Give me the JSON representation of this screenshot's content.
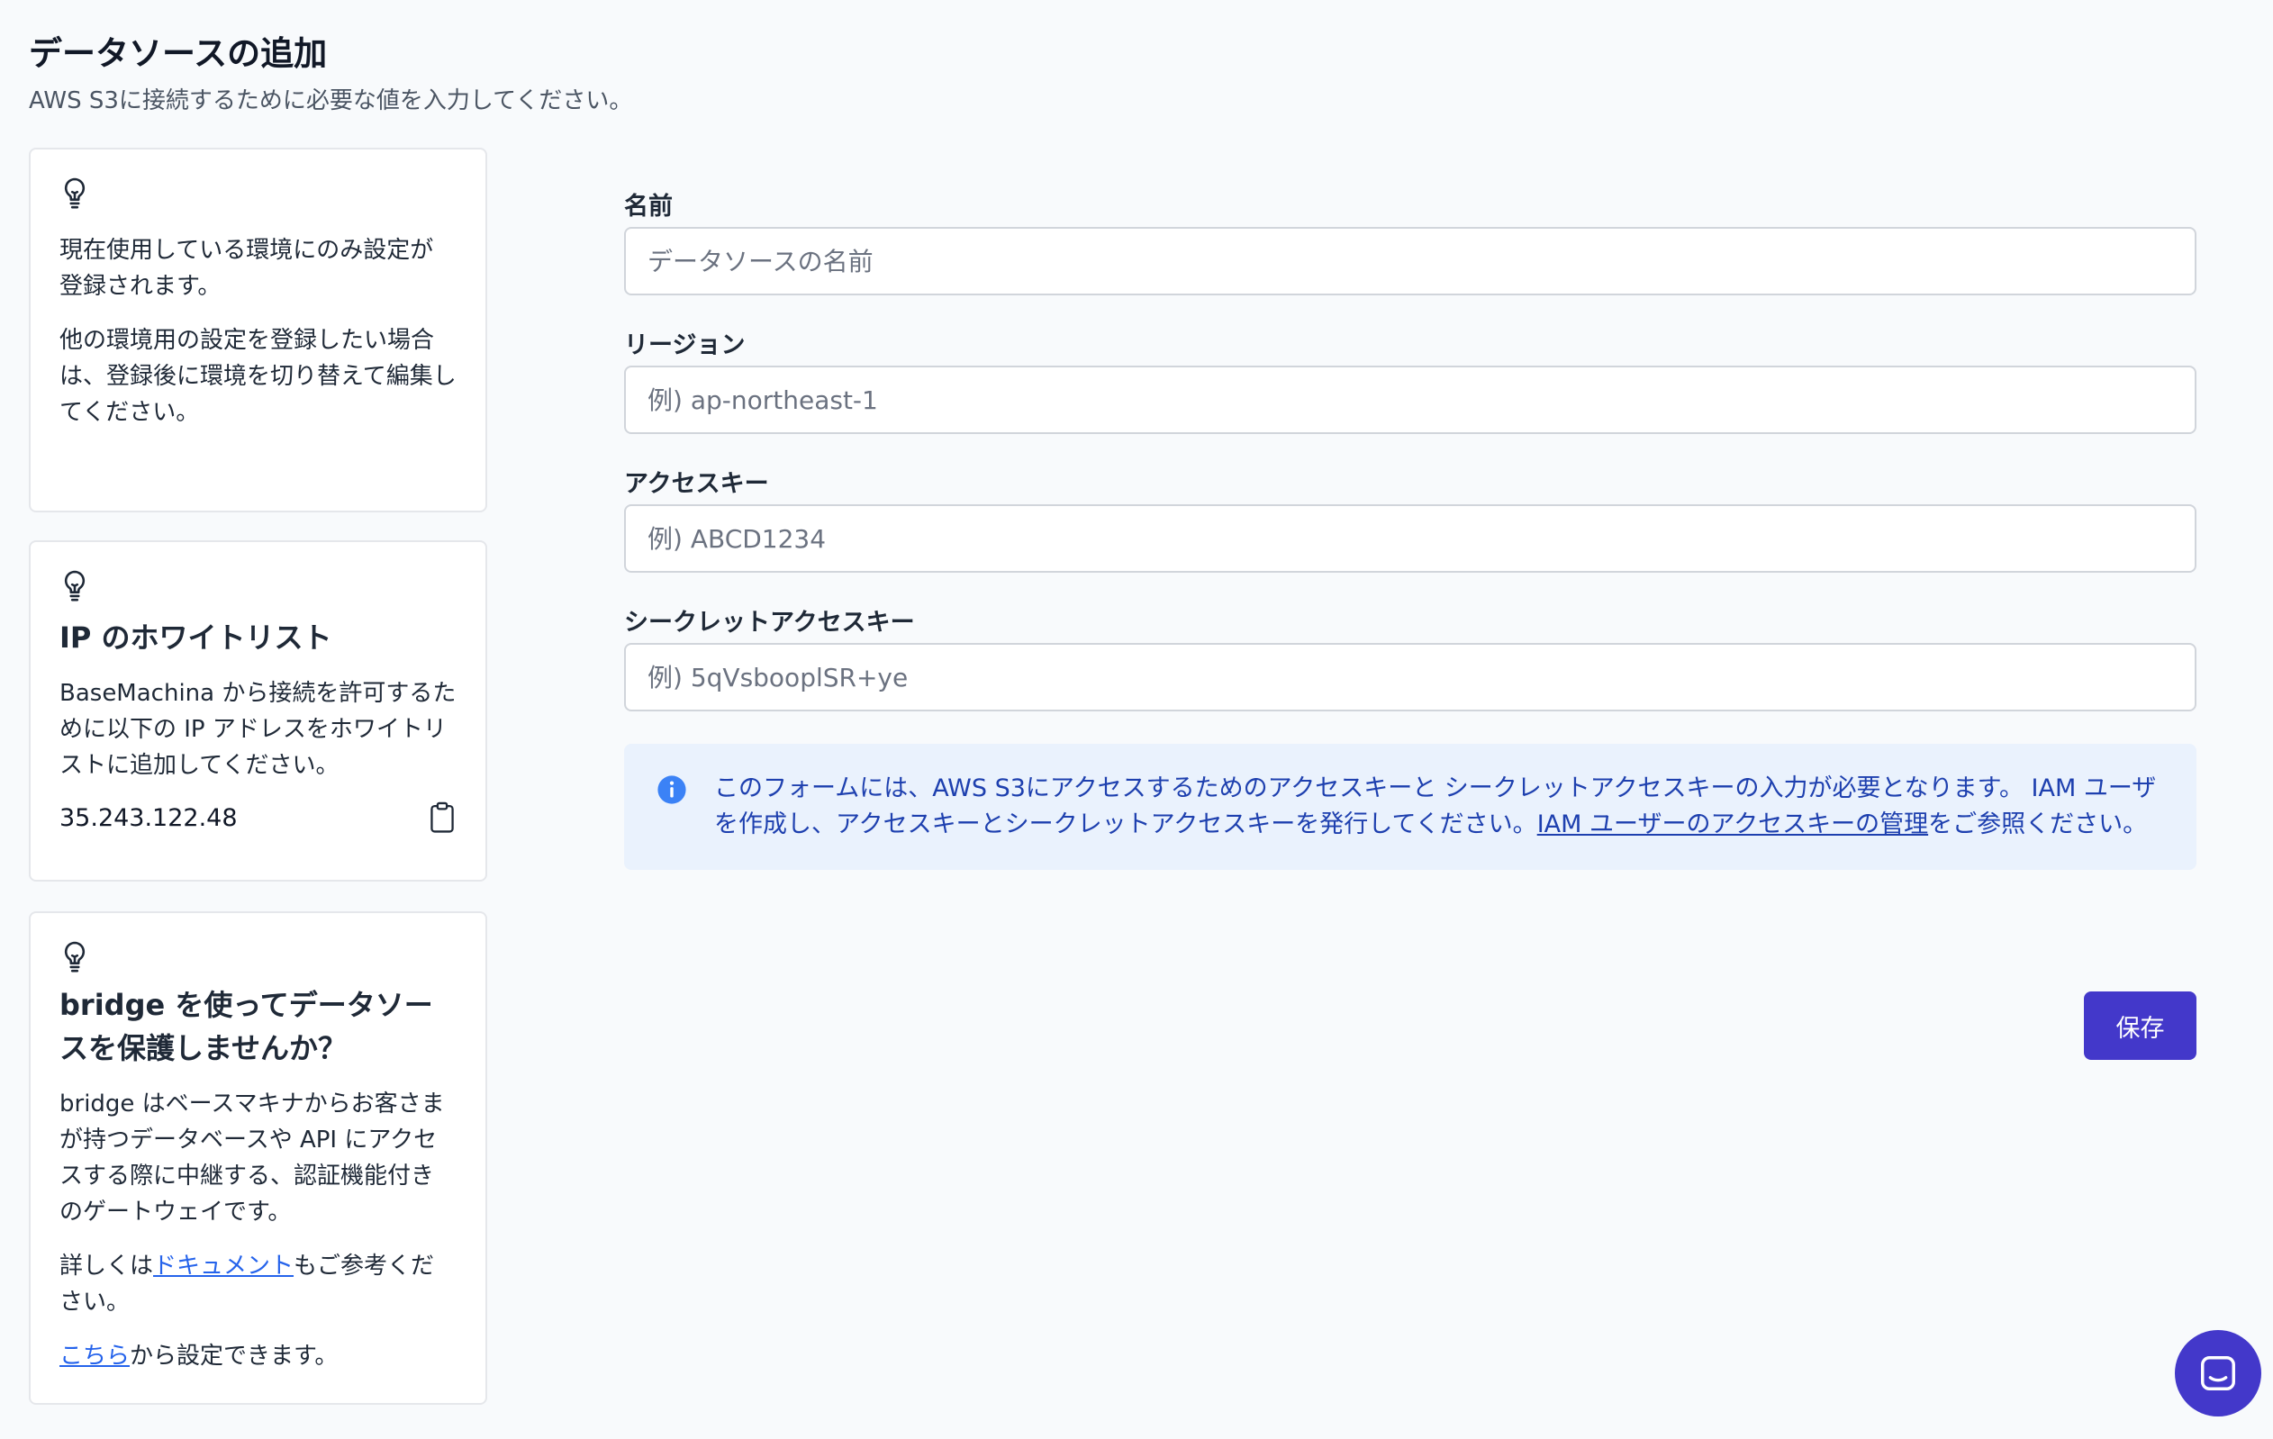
{
  "header": {
    "title": "データソースの追加",
    "subtitle": "AWS S3に接続するために必要な値を入力してください。"
  },
  "cards": {
    "env": {
      "icon": "lightbulb-icon",
      "para1": "現在使用している環境にのみ設定が登録されます。",
      "para2": "他の環境用の設定を登録したい場合は、登録後に環境を切り替えて編集してください。"
    },
    "ip": {
      "icon": "lightbulb-icon",
      "title": "IP のホワイトリスト",
      "text": "BaseMachina から接続を許可するために以下の IP アドレスをホワイトリストに追加してください。",
      "ip": "35.243.122.48",
      "copy_icon": "clipboard-icon"
    },
    "bridge": {
      "icon": "lightbulb-icon",
      "title": "bridge を使ってデータソースを保護しませんか？",
      "text": "bridge はベースマキナからお客さまが持つデータベースや API にアクセスする際に中継する、認証機能付きのゲートウェイです。",
      "detail_prefix": "詳しくは",
      "detail_link": "ドキュメント",
      "detail_suffix": "もご参考ください。",
      "setting_link": "こちら",
      "setting_suffix": "から設定できます。"
    }
  },
  "form": {
    "name": {
      "label": "名前",
      "placeholder": "データソースの名前",
      "value": ""
    },
    "region": {
      "label": "リージョン",
      "placeholder": "例) ap-northeast-1",
      "value": ""
    },
    "access_key": {
      "label": "アクセスキー",
      "placeholder": "例) ABCD1234",
      "value": ""
    },
    "secret_key": {
      "label": "シークレットアクセスキー",
      "placeholder": "例) 5qVsbooplSR+ye",
      "value": ""
    }
  },
  "info": {
    "icon": "info-icon",
    "text": "このフォームには、AWS S3にアクセスするためのアクセスキーと シークレットアクセスキーの入力が必要となります。 IAM ユーザを作成し、アクセスキーとシークレットアクセスキーを発行してください。",
    "link": "IAM ユーザーのアクセスキーの管理",
    "suffix": "をご参照ください。"
  },
  "actions": {
    "save_label": "保存"
  },
  "chat": {
    "icon": "chat-icon"
  },
  "colors": {
    "accent": "#4338ca",
    "info_bg": "#eaf2fd",
    "info_text": "#1e40af",
    "link": "#2563eb"
  }
}
